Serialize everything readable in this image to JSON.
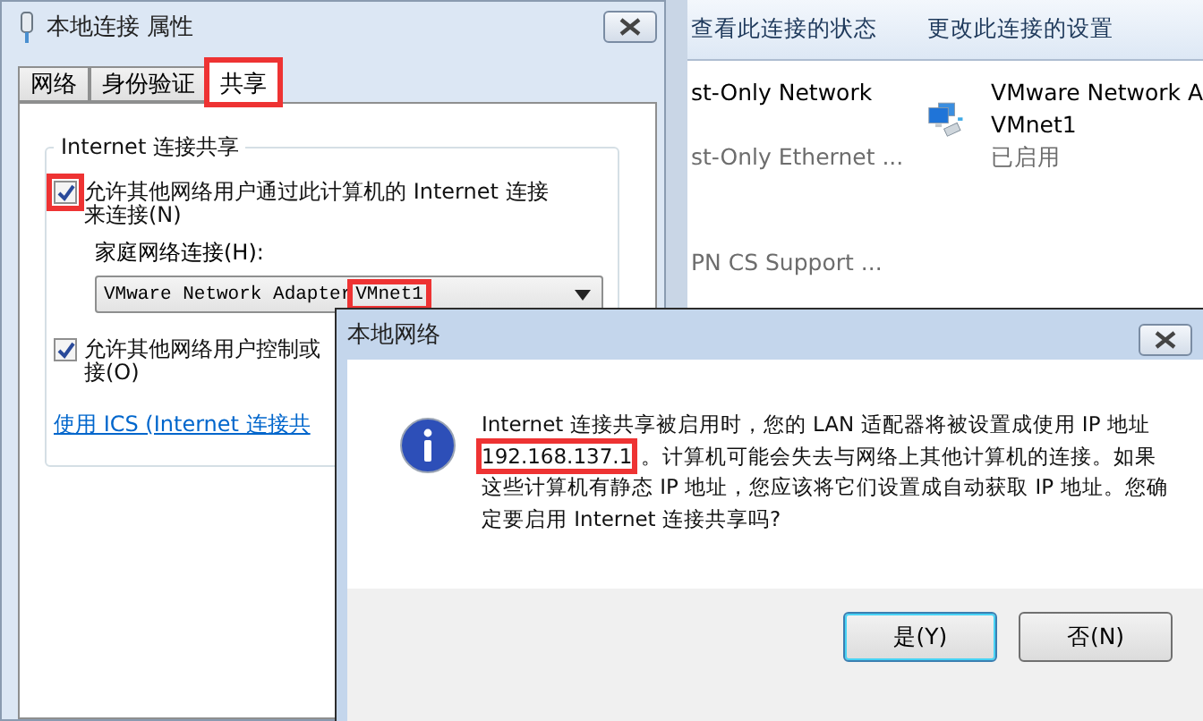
{
  "explorer": {
    "toolbar": [
      "查看此连接的状态",
      "更改此连接的设置"
    ],
    "items": [
      {
        "name": "st-Only Network",
        "detail": "st-Only Ethernet ..."
      },
      {
        "name": "PN CS Support ..."
      }
    ],
    "adapter": {
      "name": "VMware Network A",
      "network": "VMnet1",
      "status": "已启用"
    }
  },
  "properties": {
    "title": "本地连接 属性",
    "tabs": [
      {
        "label": "网络",
        "selected": false,
        "highlighted": false
      },
      {
        "label": "身份验证",
        "selected": false,
        "highlighted": false
      },
      {
        "label": "共享",
        "selected": true,
        "highlighted": true
      }
    ],
    "group_title": "Internet 连接共享",
    "allow_sharing": {
      "label": "允许其他网络用户通过此计算机的 Internet 连接来连接(N)",
      "checked": true,
      "highlighted": true
    },
    "home_network_label": "家庭网络连接(H):",
    "home_network": {
      "prefix": "VMware Network Adapter",
      "value": "VMnet1",
      "highlighted": true
    },
    "allow_control": {
      "label": "允许其他网络用户控制或",
      "label_2": "接(O)",
      "checked": true,
      "highlighted": false
    },
    "link": "使用 ICS (Internet 连接共"
  },
  "message": {
    "title": "本地网络",
    "text_before": "Internet 连接共享被启用时，您的 LAN 适配器将被设置成使用 IP 地址 ",
    "ip": "192.168.137.1",
    "text_after": "。计算机可能会失去与网络上其他计算机的连接。如果这些计算机有静态 IP 地址，您应该将它们设置成自动获取 IP 地址。您确定要启用 Internet 连接共享吗?",
    "ip_highlighted": true,
    "buttons": [
      {
        "label": "是(Y)",
        "selected": true
      },
      {
        "label": "否(N)",
        "selected": false
      }
    ]
  }
}
